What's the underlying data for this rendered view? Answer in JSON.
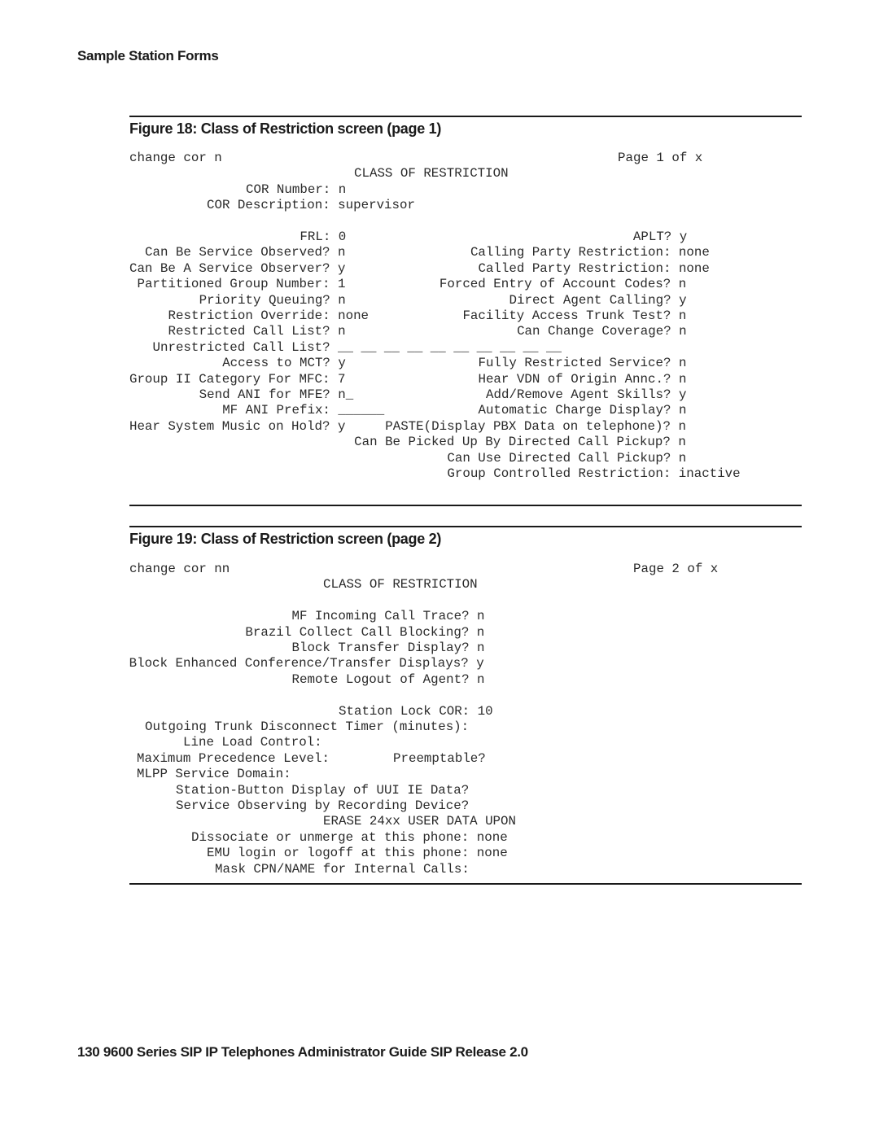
{
  "page": {
    "section_header": "Sample Station Forms",
    "footer": "130   9600 Series SIP IP Telephones Administrator Guide SIP Release 2.0"
  },
  "figure18": {
    "title": "Figure 18: Class of Restriction screen (page 1)",
    "command": "change cor n",
    "page_indicator": "Page 1 of x",
    "screen_title": "CLASS OF RESTRICTION",
    "cor_number": {
      "label": "COR Number:",
      "value": "n"
    },
    "cor_description": {
      "label": "COR Description:",
      "value": "supervisor"
    },
    "left_fields": [
      {
        "label": "FRL:",
        "value": "0"
      },
      {
        "label": "Can Be Service Observed?",
        "value": "n"
      },
      {
        "label": "Can Be A Service Observer?",
        "value": "y"
      },
      {
        "label": "Partitioned Group Number:",
        "value": "1"
      },
      {
        "label": "Priority Queuing?",
        "value": "n"
      },
      {
        "label": "Restriction Override:",
        "value": "none"
      },
      {
        "label": "Restricted Call List?",
        "value": "n"
      },
      {
        "label": "Unrestricted Call List?",
        "value": "__ __ __ __ __ __ __ __ __ __"
      },
      {
        "label": "Access to MCT?",
        "value": "y"
      },
      {
        "label": "Group II Category For MFC:",
        "value": "7"
      },
      {
        "label": "Send ANI for MFE?",
        "value": "n_"
      },
      {
        "label": "MF ANI Prefix:",
        "value": "______"
      },
      {
        "label": "Hear System Music on Hold?",
        "value": "y"
      }
    ],
    "right_fields": [
      {
        "label": "APLT?",
        "value": "y"
      },
      {
        "label": "Calling Party Restriction:",
        "value": "none"
      },
      {
        "label": "Called Party Restriction:",
        "value": "none"
      },
      {
        "label": "Forced Entry of Account Codes?",
        "value": "n"
      },
      {
        "label": "Direct Agent Calling?",
        "value": "y"
      },
      {
        "label": "Facility Access Trunk Test?",
        "value": "n"
      },
      {
        "label": "Can Change Coverage?",
        "value": "n"
      },
      {
        "label": "",
        "value": ""
      },
      {
        "label": "Fully Restricted Service?",
        "value": "n"
      },
      {
        "label": "Hear VDN of Origin Annc.?",
        "value": "n"
      },
      {
        "label": "Add/Remove Agent Skills?",
        "value": "y"
      },
      {
        "label": "Automatic Charge Display?",
        "value": "n"
      },
      {
        "label": "PASTE(Display PBX Data on telephone)?",
        "value": "n"
      },
      {
        "label": "Can Be Picked Up By Directed Call Pickup?",
        "value": "n"
      },
      {
        "label": "Can Use Directed Call Pickup?",
        "value": "n"
      },
      {
        "label": "Group Controlled Restriction:",
        "value": "inactive"
      }
    ]
  },
  "figure19": {
    "title": "Figure 19: Class of Restriction screen (page 2)",
    "command": "change cor nn",
    "page_indicator": "Page 2 of x",
    "screen_title": "CLASS OF RESTRICTION",
    "fields_a": [
      {
        "label": "MF Incoming Call Trace?",
        "value": "n"
      },
      {
        "label": "Brazil Collect Call Blocking?",
        "value": "n"
      },
      {
        "label": "Block Transfer Display?",
        "value": "n"
      },
      {
        "label": "Block Enhanced Conference/Transfer Displays?",
        "value": "y"
      },
      {
        "label": "Remote Logout of Agent?",
        "value": "n"
      }
    ],
    "station_lock": {
      "label": "Station Lock COR:",
      "value": "10"
    },
    "outgoing_trunk": {
      "label": "Outgoing Trunk Disconnect Timer (minutes):",
      "value": ""
    },
    "line_load": {
      "label": "Line Load Control:",
      "value": ""
    },
    "max_precedence": {
      "label": "Maximum Precedence Level:",
      "value": ""
    },
    "preemptable": {
      "label": "Preemptable?",
      "value": ""
    },
    "mlpp": {
      "label": "MLPP Service Domain:",
      "value": ""
    },
    "station_button": {
      "label": "Station-Button Display of UUI IE Data?",
      "value": ""
    },
    "service_observing": {
      "label": "Service Observing by Recording Device?",
      "value": ""
    },
    "erase_header": "ERASE 24xx USER DATA UPON",
    "dissociate": {
      "label": "Dissociate or unmerge at this phone:",
      "value": "none"
    },
    "emu": {
      "label": "EMU login or logoff at this phone:",
      "value": "none"
    },
    "mask_cpn": {
      "label": "Mask CPN/NAME for Internal Calls:",
      "value": ""
    }
  }
}
